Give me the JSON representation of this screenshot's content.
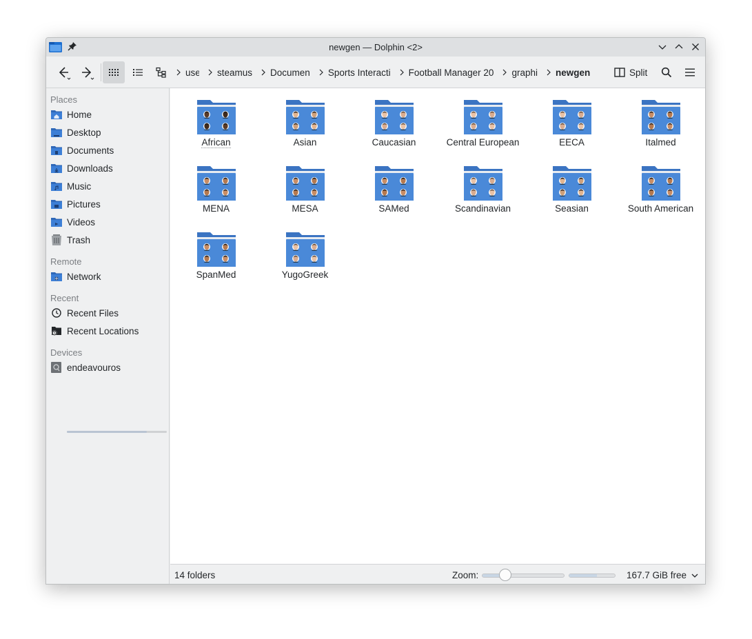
{
  "window": {
    "title": "newgen — Dolphin <2>"
  },
  "toolbar": {
    "breadcrumbs": [
      {
        "label": "use",
        "width": 20
      },
      {
        "label": "steamus",
        "width": 52
      },
      {
        "label": "Documen",
        "width": 58
      },
      {
        "label": "Sports Interacti",
        "width": 96
      },
      {
        "label": "Football Manager 20",
        "width": 128
      },
      {
        "label": "graphi",
        "width": 40
      },
      {
        "label": "newgen",
        "width": 52
      }
    ],
    "split_label": "Split"
  },
  "sidebar": {
    "sections": [
      {
        "title": "Places",
        "items": [
          {
            "label": "Home",
            "icon": "home-folder-icon"
          },
          {
            "label": "Desktop",
            "icon": "desktop-folder-icon"
          },
          {
            "label": "Documents",
            "icon": "documents-folder-icon"
          },
          {
            "label": "Downloads",
            "icon": "downloads-folder-icon"
          },
          {
            "label": "Music",
            "icon": "music-folder-icon"
          },
          {
            "label": "Pictures",
            "icon": "pictures-folder-icon"
          },
          {
            "label": "Videos",
            "icon": "videos-folder-icon"
          },
          {
            "label": "Trash",
            "icon": "trash-icon"
          }
        ]
      },
      {
        "title": "Remote",
        "items": [
          {
            "label": "Network",
            "icon": "network-folder-icon"
          }
        ]
      },
      {
        "title": "Recent",
        "items": [
          {
            "label": "Recent Files",
            "icon": "clock-icon"
          },
          {
            "label": "Recent Locations",
            "icon": "recent-locations-icon"
          }
        ]
      },
      {
        "title": "Devices",
        "items": [
          {
            "label": "endeavouros",
            "icon": "drive-icon"
          }
        ]
      }
    ],
    "device_usage": 0.8
  },
  "folders": [
    {
      "label": "African",
      "skin": "dark"
    },
    {
      "label": "Asian",
      "skin": "light"
    },
    {
      "label": "Caucasian",
      "skin": "pale"
    },
    {
      "label": "Central European",
      "skin": "pale"
    },
    {
      "label": "EECA",
      "skin": "pale"
    },
    {
      "label": "Italmed",
      "skin": "medium"
    },
    {
      "label": "MENA",
      "skin": "medium"
    },
    {
      "label": "MESA",
      "skin": "medium"
    },
    {
      "label": "SAMed",
      "skin": "medium"
    },
    {
      "label": "Scandinavian",
      "skin": "pale"
    },
    {
      "label": "Seasian",
      "skin": "light"
    },
    {
      "label": "South American",
      "skin": "medium"
    },
    {
      "label": "SpanMed",
      "skin": "medium"
    },
    {
      "label": "YugoGreek",
      "skin": "pale"
    }
  ],
  "statusbar": {
    "count": "14 folders",
    "zoom_label": "Zoom:",
    "zoom_level": 0.3,
    "disk_usage": 0.6,
    "free_space": "167.7 GiB free"
  },
  "colors": {
    "folder_blue": "#4a89d8",
    "folder_tab": "#3b74c2",
    "accent": "#3daee9"
  }
}
